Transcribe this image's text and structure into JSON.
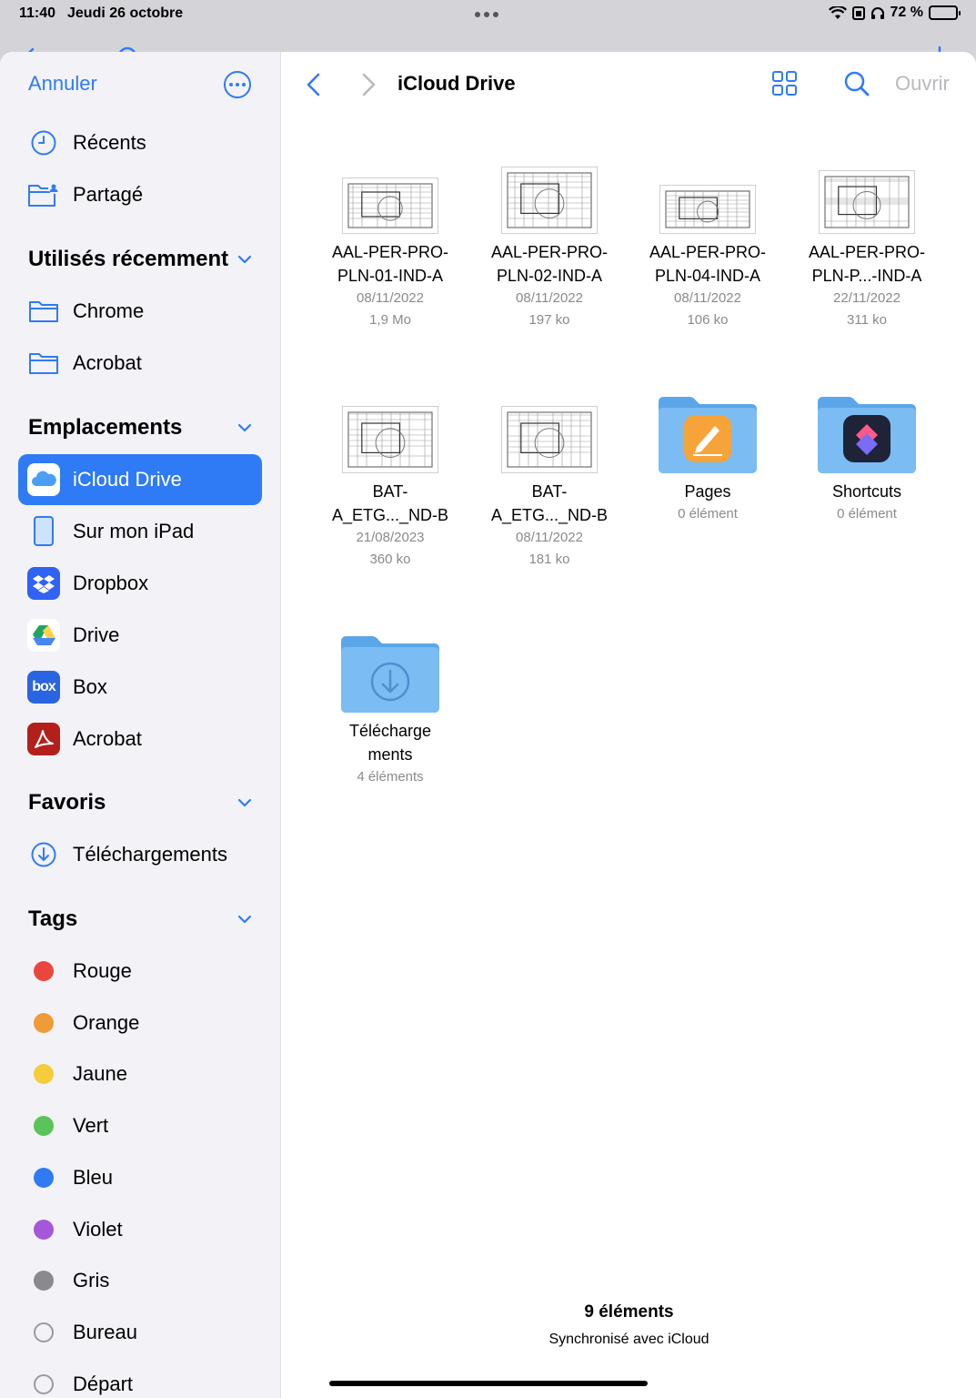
{
  "status": {
    "time": "11:40",
    "date": "Jeudi 26 octobre",
    "battery": "72 %",
    "battery_level": 0.72
  },
  "sidebar": {
    "cancel_label": "Annuler",
    "top_items": [
      {
        "label": "Récents",
        "icon": "clock-icon"
      },
      {
        "label": "Partagé",
        "icon": "shared-folder-icon"
      }
    ],
    "recent_header": "Utilisés récemment",
    "recent_items": [
      {
        "label": "Chrome",
        "icon": "folder-icon"
      },
      {
        "label": "Acrobat",
        "icon": "folder-icon"
      }
    ],
    "locations_header": "Emplacements",
    "locations": [
      {
        "label": "iCloud Drive",
        "icon": "icloud-icon",
        "active": true
      },
      {
        "label": "Sur mon iPad",
        "icon": "ipad-icon"
      },
      {
        "label": "Dropbox",
        "icon": "dropbox-icon"
      },
      {
        "label": "Drive",
        "icon": "google-drive-icon"
      },
      {
        "label": "Box",
        "icon": "box-icon",
        "badge": "box"
      },
      {
        "label": "Acrobat",
        "icon": "acrobat-icon"
      }
    ],
    "favorites_header": "Favoris",
    "favorites": [
      {
        "label": "Téléchargements",
        "icon": "download-icon"
      }
    ],
    "tags_header": "Tags",
    "tags": [
      {
        "label": "Rouge",
        "color": "#e9473d"
      },
      {
        "label": "Orange",
        "color": "#f19a38"
      },
      {
        "label": "Jaune",
        "color": "#f5cd3c"
      },
      {
        "label": "Vert",
        "color": "#5ac45a"
      },
      {
        "label": "Bleu",
        "color": "#2f7bf5"
      },
      {
        "label": "Violet",
        "color": "#a458d9"
      },
      {
        "label": "Gris",
        "color": "#8a8a8e"
      },
      {
        "label": "Bureau",
        "color": ""
      },
      {
        "label": "Départ",
        "color": ""
      }
    ]
  },
  "main": {
    "title": "iCloud Drive",
    "open_label": "Ouvrir",
    "items": [
      {
        "name1": "AAL-PER-PRO-",
        "name2": "PLN-01-IND-A",
        "date": "08/11/2022",
        "size": "1,9 Mo",
        "kind": "doc"
      },
      {
        "name1": "AAL-PER-PRO-",
        "name2": "PLN-02-IND-A",
        "date": "08/11/2022",
        "size": "197 ko",
        "kind": "doc"
      },
      {
        "name1": "AAL-PER-PRO-",
        "name2": "PLN-04-IND-A",
        "date": "08/11/2022",
        "size": "106 ko",
        "kind": "doc"
      },
      {
        "name1": "AAL-PER-PRO-",
        "name2": "PLN-P...-IND-A",
        "date": "22/11/2022",
        "size": "311 ko",
        "kind": "doc"
      },
      {
        "name1": "BAT-",
        "name2": "A_ETG..._ND-B",
        "date": "21/08/2023",
        "size": "360 ko",
        "kind": "doc"
      },
      {
        "name1": "BAT-",
        "name2": "A_ETG..._ND-B",
        "date": "08/11/2022",
        "size": "181 ko",
        "kind": "doc"
      },
      {
        "name1": "Pages",
        "name2": "",
        "date": "0 élément",
        "size": "",
        "kind": "folder-pages"
      },
      {
        "name1": "Shortcuts",
        "name2": "",
        "date": "0 élément",
        "size": "",
        "kind": "folder-shortcuts"
      },
      {
        "name1": "Télécharge",
        "name2": "ments",
        "date": "4 éléments",
        "size": "",
        "kind": "folder-downloads"
      }
    ],
    "footer_count": "9 éléments",
    "footer_sync": "Synchronisé avec iCloud"
  }
}
